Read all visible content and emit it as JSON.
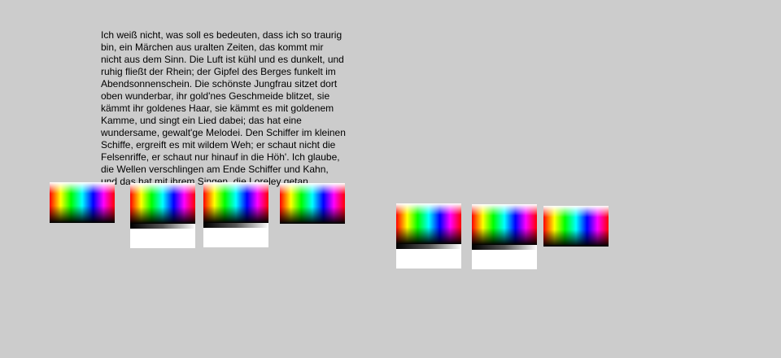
{
  "poem": {
    "text": "Ich weiß nicht, was soll es bedeuten, dass ich so traurig bin, ein Märchen aus uralten Zeiten, das kommt mir nicht aus dem Sinn. Die Luft ist kühl und es dunkelt, und ruhig fließt der Rhein; der Gipfel des Berges funkelt im Abendsonnenschein. Die schönste Jungfrau sitzet dort oben wunderbar, ihr gold'nes Geschmeide blitzet, sie kämmt ihr goldenes Haar, sie kämmt es mit goldenem Kamme, und singt ein Lied dabei; das hat eine wundersame, gewalt'ge Melodei. Den Schiffer im kleinen Schiffe, ergreift es mit wildem Weh; er schaut nicht die Felsenriffe, er schaut nur hinauf in die Höh'. Ich glaube, die Wellen verschlingen am Ende Schiffer und Kahn, und das hat mit ihrem Singen, die Loreley getan."
  },
  "colors": {
    "background": "#cccccc",
    "text": "#000000",
    "swatch_base": "#ffffff"
  },
  "swatches": [
    {
      "id": "swatch-1",
      "style": "spectrum-gradient"
    },
    {
      "id": "swatch-2",
      "style": "spectrum-gradient-with-fade"
    },
    {
      "id": "swatch-3",
      "style": "spectrum-gradient-with-fade"
    },
    {
      "id": "swatch-4",
      "style": "spectrum-gradient"
    },
    {
      "id": "swatch-5",
      "style": "spectrum-gradient-with-fade"
    },
    {
      "id": "swatch-6",
      "style": "spectrum-gradient-with-fade"
    },
    {
      "id": "swatch-7",
      "style": "spectrum-gradient"
    }
  ]
}
